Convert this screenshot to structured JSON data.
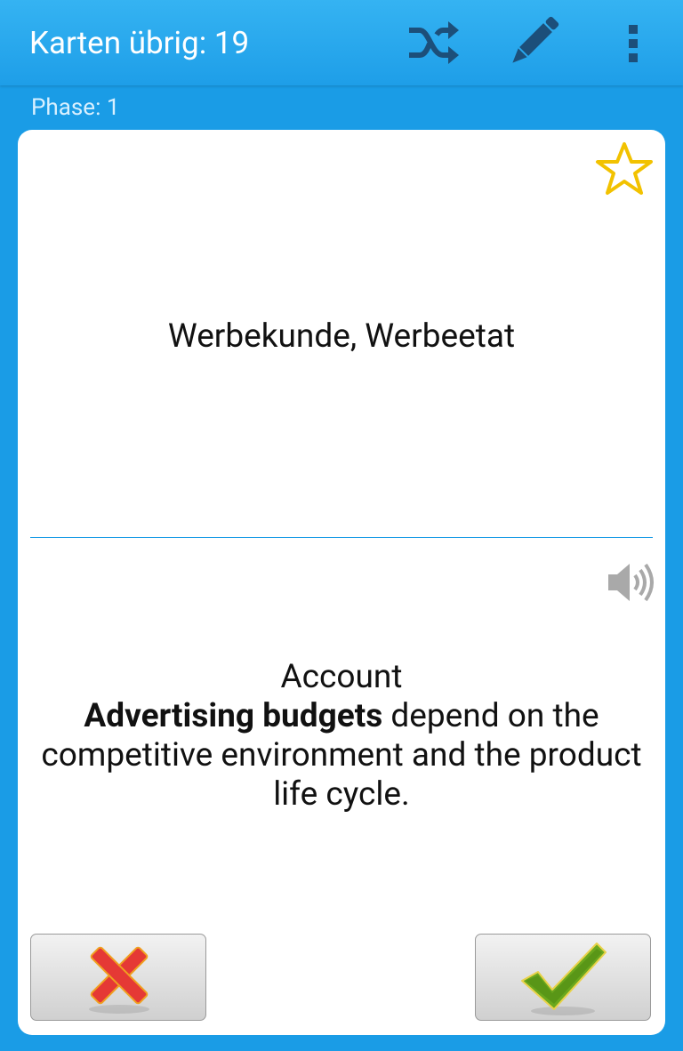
{
  "header": {
    "title": "Karten übrig: 19",
    "icons": [
      "shuffle-icon",
      "pencil-icon",
      "overflow-menu-icon"
    ]
  },
  "phase_label": "Phase: 1",
  "card": {
    "favorite_icon": "star-outline-icon",
    "question": "Werbekunde, Werbeetat",
    "audio_icon": "speaker-icon",
    "answer": {
      "line1": "Account",
      "bold_phrase": "Advertising budgets",
      "rest": " depend on the competitive environment and the product life cycle."
    }
  },
  "buttons": {
    "wrong_icon": "red-x-icon",
    "right_icon": "green-check-icon"
  },
  "colors": {
    "background": "#1a9ce6",
    "toolbar_icon": "#1c4f7a",
    "star": "#f2c200",
    "wrong": "#e53935",
    "right": "#6aa81e"
  }
}
